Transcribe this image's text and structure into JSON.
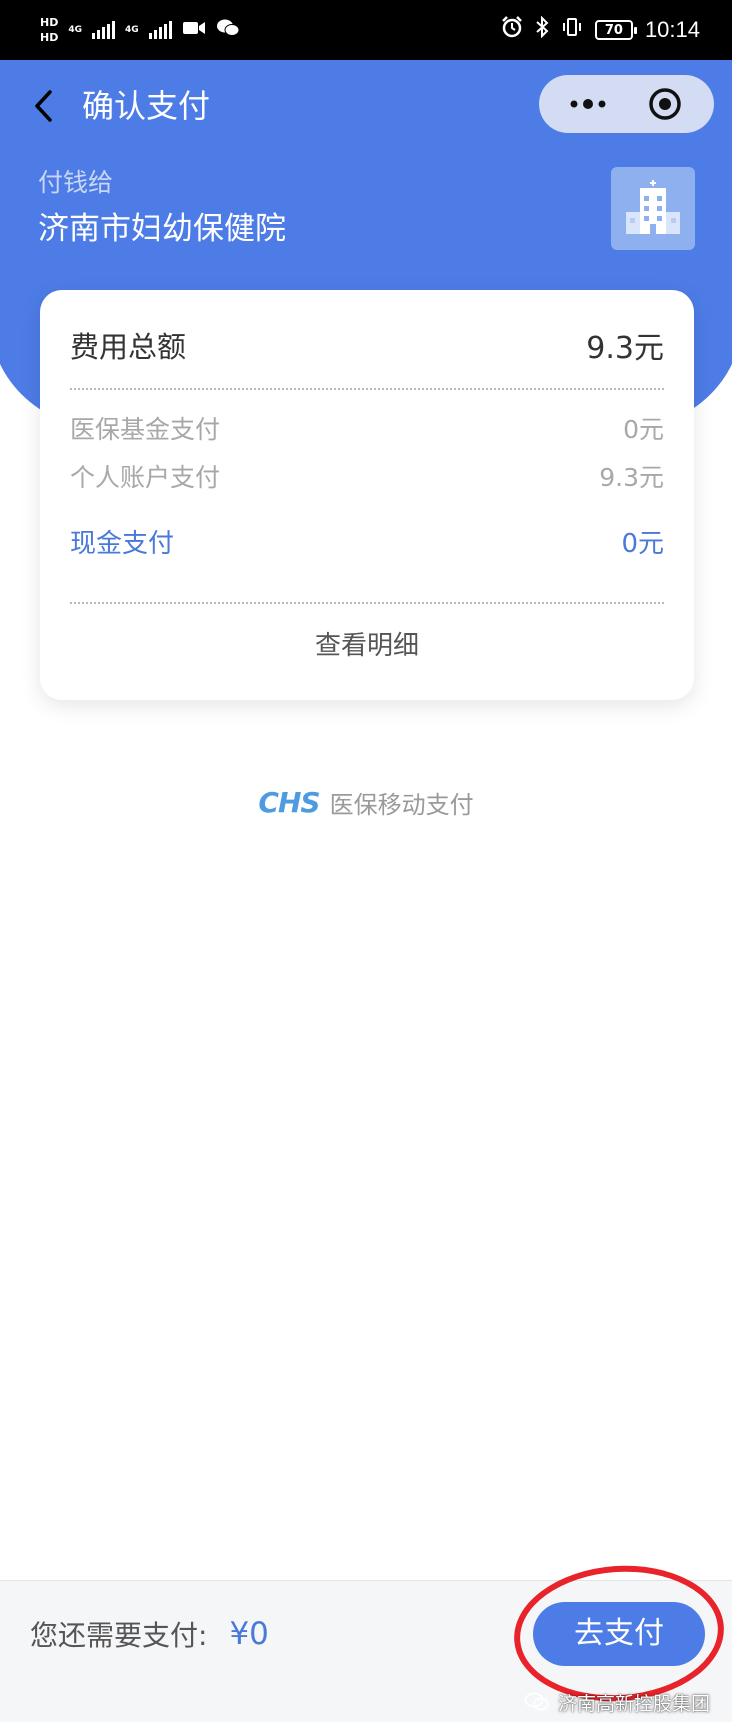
{
  "status_bar": {
    "hd_1": "HD",
    "hd_2": "HD",
    "network_1": "4G",
    "network_2": "4G",
    "battery": "70",
    "time": "10:14",
    "icons": [
      "alarm-icon",
      "bluetooth-icon",
      "vibrate-icon",
      "video-icon",
      "wechat-icon"
    ]
  },
  "nav": {
    "title": "确认支付",
    "back_icon": "chevron-left-icon",
    "more_icon": "more-dots-icon",
    "close_icon": "target-close-icon"
  },
  "payee": {
    "label": "付钱给",
    "name": "济南市妇幼保健院",
    "icon": "hospital-building-icon"
  },
  "summary": {
    "total_label": "费用总额",
    "total_amount": "9.3元",
    "rows": [
      {
        "label": "医保基金支付",
        "amount": "0元"
      },
      {
        "label": "个人账户支付",
        "amount": "9.3元"
      }
    ],
    "cash_label": "现金支付",
    "cash_amount": "0元",
    "detail_link": "查看明细"
  },
  "brand": {
    "logo": "CHS",
    "text": "医保移动支付"
  },
  "footer": {
    "remaining_label": "您还需要支付:",
    "remaining_amount": "¥0",
    "pay_button": "去支付"
  },
  "watermark": {
    "text": "济南高新控股集团"
  },
  "colors": {
    "primary": "#4d7ce6",
    "link": "#4a79d9",
    "highlight": "#e8232a"
  }
}
